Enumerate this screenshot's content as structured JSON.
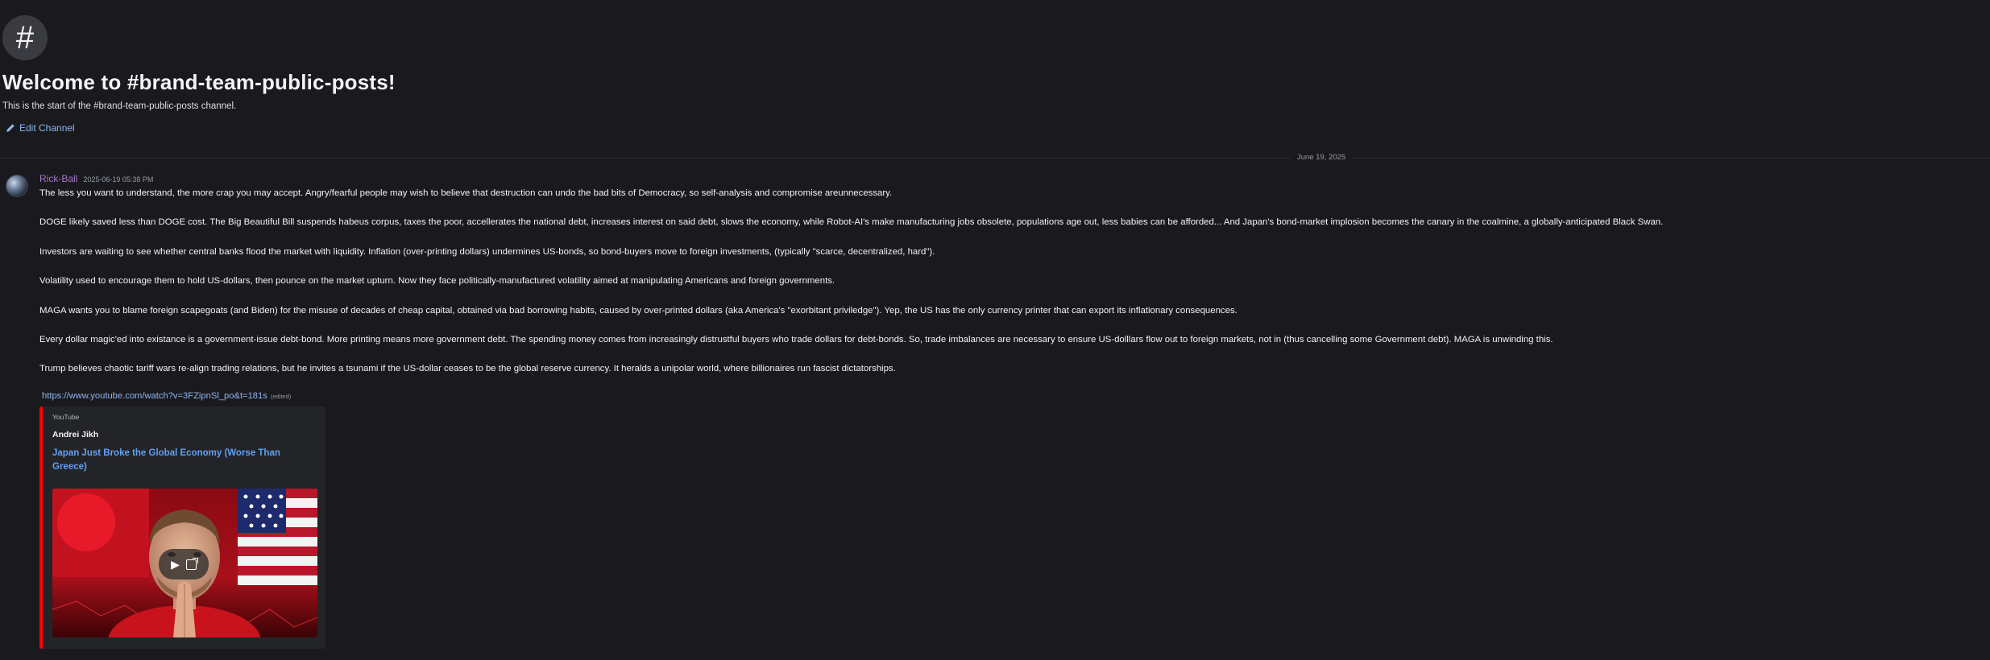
{
  "welcome": {
    "icon": "hash-icon",
    "title": "Welcome to #brand-team-public-posts!",
    "subtitle": "This is the start of the #brand-team-public-posts channel.",
    "edit_label": "Edit Channel"
  },
  "date_divider": "June 19, 2025",
  "message": {
    "username": "Rick-Ball",
    "username_color": "#a775c9",
    "timestamp": "2025-06-19 05:38 PM",
    "paragraphs": [
      "The less you want to understand, the more crap you may accept.  Angry/fearful people may wish to believe that destruction can undo the bad bits of Democracy, so self-analysis and compromise areunnecessary.",
      "DOGE likely saved less than DOGE cost.  The Big Beautiful Bill suspends habeus corpus, taxes the poor, accellerates the national debt, increases interest on said debt, slows the economy, while Robot-AI's make manufacturing jobs obsolete, populations age out, less babies can be afforded...  And Japan's bond-market implosion becomes the canary in the coalmine, a globally-anticipated Black Swan.",
      "Investors are waiting to see whether central banks flood the market with liquidity.  Inflation (over-printing dollars) undermines US-bonds, so bond-buyers move to foreign investments, (typically \"scarce, decentralized, hard\").",
      "Volatility used to encourage them to hold US-dollars, then pounce on the market upturn.  Now they face politically-manufactured volatility aimed at manipulating Americans and foreign governments.",
      "MAGA wants you to blame foreign scapegoats (and Biden) for the misuse of decades of cheap capital, obtained via bad borrowing habits, caused by over-printed dollars (aka America's \"exorbitant priviledge\").   Yep, the US has the only currency printer that can export its inflationary consequences.",
      "Every dollar magic'ed into existance is a government-issue debt-bond.  More printing means more government debt.  The spending money comes from increasingly distrustful buyers who trade dollars for debt-bonds.  So, trade imbalances are necessary to ensure US-dolllars flow out to foreign markets, not in (thus cancelling some Government debt).  MAGA is unwinding this.",
      "Trump believes chaotic tariff wars re-align trading relations, but he invites a tsunami if the US-dollar ceases to be the global reserve currency.  It heralds a unipolar world, where billionaires run fascist dictatorships."
    ],
    "link": "https://www.youtube.com/watch?v=3FZipnSl_po&t=181s",
    "edited_label": "(edited)",
    "embed": {
      "provider": "YouTube",
      "author": "Andrei Jikh",
      "title": "Japan Just Broke the Global Economy (Worse Than Greece)",
      "accent_color": "#ff0000",
      "thumbnail": "video-thumbnail",
      "play_icon": "play-icon",
      "external_icon": "external-link-icon"
    }
  }
}
